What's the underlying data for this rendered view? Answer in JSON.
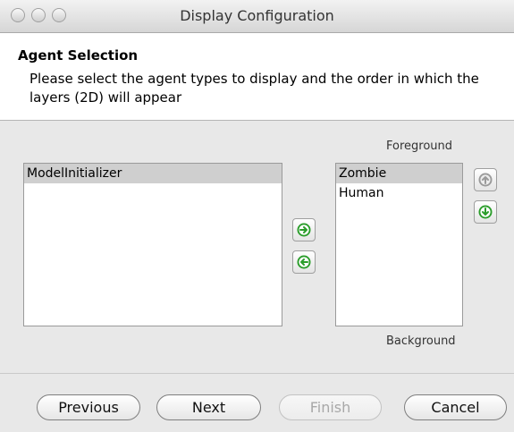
{
  "window": {
    "title": "Display Configuration"
  },
  "header": {
    "title": "Agent Selection",
    "description": "Please select the agent types to display and the order in which the layers (2D) will appear"
  },
  "labels": {
    "foreground": "Foreground",
    "background": "Background"
  },
  "available_list": {
    "items": [
      "ModelInitializer"
    ]
  },
  "selected_list": {
    "items": [
      "Zombie",
      "Human"
    ]
  },
  "icons": {
    "add": "arrow-right-icon",
    "remove": "arrow-left-icon",
    "move_up": "arrow-up-icon",
    "move_down": "arrow-down-icon"
  },
  "buttons": {
    "previous": "Previous",
    "next": "Next",
    "finish": "Finish",
    "cancel": "Cancel"
  },
  "colors": {
    "arrow_green": "#2a9d2a",
    "arrow_disabled": "#9a9a9a"
  }
}
